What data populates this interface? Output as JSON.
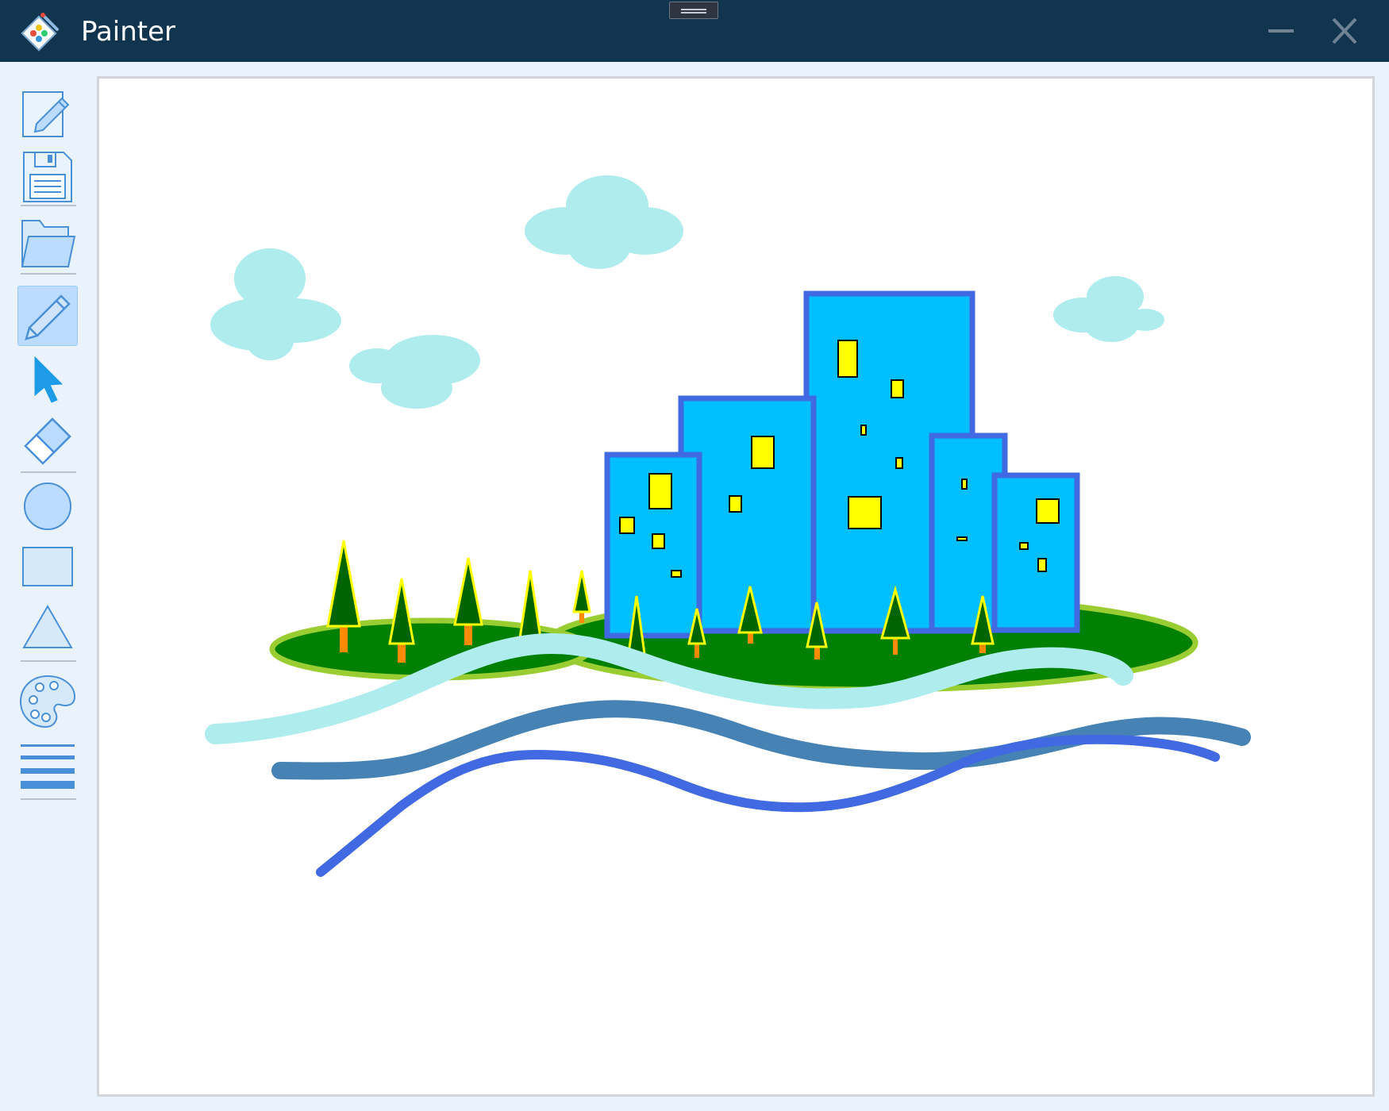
{
  "window": {
    "title": "Painter",
    "controls": [
      "minimize",
      "close"
    ]
  },
  "toolbar": {
    "tools": [
      {
        "name": "new",
        "icon": "new-file-icon",
        "active": false
      },
      {
        "name": "save",
        "icon": "save-icon",
        "active": false
      },
      {
        "name": "open",
        "icon": "open-folder-icon",
        "active": false
      },
      {
        "name": "pencil",
        "icon": "pencil-icon",
        "active": true
      },
      {
        "name": "select",
        "icon": "pointer-icon",
        "active": false
      },
      {
        "name": "eraser",
        "icon": "eraser-icon",
        "active": false
      },
      {
        "name": "circle",
        "icon": "circle-icon",
        "active": false
      },
      {
        "name": "rectangle",
        "icon": "rectangle-icon",
        "active": false
      },
      {
        "name": "triangle",
        "icon": "triangle-icon",
        "active": false
      },
      {
        "name": "color-palette",
        "icon": "palette-icon",
        "active": false
      },
      {
        "name": "line-width",
        "icon": "line-width-icon",
        "active": false
      }
    ]
  },
  "colors": {
    "titlebar": "#12354f",
    "toolbar_background": "#eaf3fc",
    "active_tool": "#bcdcff",
    "icon_blue": "#4a90d9",
    "canvas": "#ffffff",
    "cloud": "#aeecee",
    "building_fill": "#00bfff",
    "building_stroke": "#4169e1",
    "window_fill": "#ffff00",
    "ground_fill": "#008000",
    "ground_stroke": "#9acd32",
    "tree_trunk": "#ff8c00",
    "wave_light": "#aeecee",
    "wave_mid": "#4682b4",
    "wave_dark": "#4169e1"
  }
}
